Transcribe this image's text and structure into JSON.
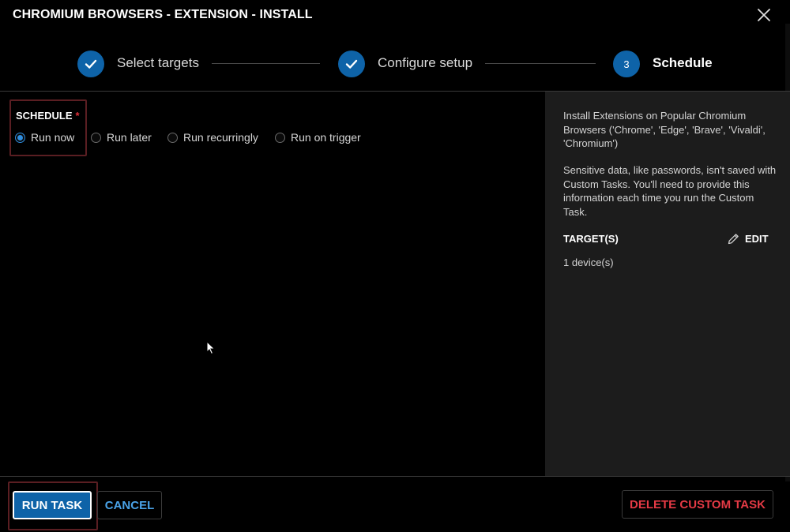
{
  "dialog": {
    "title": "CHROMIUM BROWSERS - EXTENSION - INSTALL",
    "close_icon": "close-icon"
  },
  "stepper": {
    "steps": [
      {
        "label": "Select targets",
        "state": "completed",
        "icon": "checkmark-icon"
      },
      {
        "label": "Configure setup",
        "state": "completed",
        "icon": "checkmark-icon"
      },
      {
        "label": "Schedule",
        "state": "active",
        "number": "3"
      }
    ]
  },
  "schedule": {
    "label": "SCHEDULE",
    "required_marker": "*",
    "options": [
      {
        "label": "Run now",
        "selected": true
      },
      {
        "label": "Run later",
        "selected": false
      },
      {
        "label": "Run recurringly",
        "selected": false
      },
      {
        "label": "Run on trigger",
        "selected": false
      }
    ]
  },
  "info_panel": {
    "description": "Install Extensions on Popular Chromium Browsers ('Chrome', 'Edge', 'Brave', 'Vivaldi', 'Chromium')",
    "note": "Sensitive data, like passwords, isn't saved with Custom Tasks. You'll need to provide this information each time you run the Custom Task.",
    "targets_heading": "TARGET(S)",
    "edit_label": "EDIT",
    "edit_icon": "pencil-icon",
    "targets_value": "1 device(s)"
  },
  "footer": {
    "run_task_label": "RUN TASK",
    "cancel_label": "CANCEL",
    "delete_label": "DELETE CUSTOM TASK"
  },
  "colors": {
    "background": "#000000",
    "panel_background": "#1c1c1c",
    "accent_blue": "#0e63a8",
    "link_blue": "#4aa3e8",
    "danger_red": "#e53a45",
    "required_red": "#e0303a",
    "highlight_border": "#5a1e22"
  }
}
